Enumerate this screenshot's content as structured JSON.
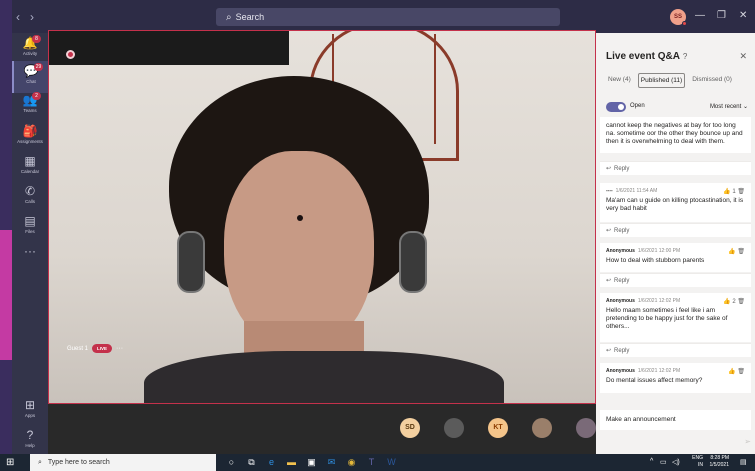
{
  "titlebar": {
    "back": "‹",
    "forward": "›",
    "search_placeholder": "Search",
    "avatar_initials": "SS",
    "min": "—",
    "max": "❐",
    "close": "✕"
  },
  "rail": [
    {
      "label": "Activity",
      "icon": "🔔",
      "badge": "8"
    },
    {
      "label": "Chat",
      "icon": "💬",
      "badge": "29"
    },
    {
      "label": "Teams",
      "icon": "👥",
      "badge": "2"
    },
    {
      "label": "Assignments",
      "icon": "🎒",
      "badge": ""
    },
    {
      "label": "Calendar",
      "icon": "▦",
      "badge": ""
    },
    {
      "label": "Calls",
      "icon": "✆",
      "badge": ""
    },
    {
      "label": "Files",
      "icon": "▤",
      "badge": ""
    },
    {
      "label": "···",
      "icon": "",
      "badge": ""
    },
    {
      "label": "Apps",
      "icon": "⊞",
      "badge": ""
    },
    {
      "label": "Help",
      "icon": "?",
      "badge": ""
    }
  ],
  "video": {
    "guest_name": "Guest 1",
    "live_label": "LIVE",
    "more": "···"
  },
  "participants": [
    {
      "initials": "SD",
      "bg": "#f3d0a0",
      "fg": "#5a3a10"
    },
    {
      "initials": "",
      "bg": "#5b5b5b",
      "fg": "#fff"
    },
    {
      "initials": "KT",
      "bg": "#f4c48a",
      "fg": "#8a3b00"
    },
    {
      "initials": "",
      "bg": "#9a7f6a",
      "fg": "#fff"
    },
    {
      "initials": "",
      "bg": "#7a6a78",
      "fg": "#fff"
    }
  ],
  "qa": {
    "title": "Live event Q&A",
    "help_icon": "?",
    "close": "✕",
    "tabs": [
      {
        "label": "New (4)",
        "selected": false
      },
      {
        "label": "Published (11)",
        "selected": true
      },
      {
        "label": "Dismissed (0)",
        "selected": false
      }
    ],
    "toggle_label": "Open",
    "sort_label": "Most recent",
    "reply_label": "Reply",
    "items": [
      {
        "author": "",
        "time": "",
        "likes": "",
        "text": "cannot keep the negatives at bay for too long na. sometime oor the other they bounce up and then it is overwhelming to deal with them."
      },
      {
        "author": "----",
        "time": "1/6/2021 11:54 AM",
        "likes": "1",
        "text": "Ma'am can u guide on killing ptocastination, it is very bad habit"
      },
      {
        "author": "Anonymous",
        "time": "1/6/2021 12:00 PM",
        "likes": "",
        "text": "How to deal with stubborn parents"
      },
      {
        "author": "Anonymous",
        "time": "1/6/2021 12:02 PM",
        "likes": "2",
        "text": "Hello maam sometimes i feel like i am pretending to be happy just for the sake of others..."
      },
      {
        "author": "Anonymous",
        "time": "1/6/2021 12:02 PM",
        "likes": "",
        "text": "Do mental issues affect memory?"
      }
    ],
    "announce_placeholder": "Make an announcement"
  },
  "taskbar": {
    "search_placeholder": "Type here to search",
    "lang": "ENG",
    "region": "IN",
    "time": "8:28 PM",
    "date": "1/5/2021"
  }
}
